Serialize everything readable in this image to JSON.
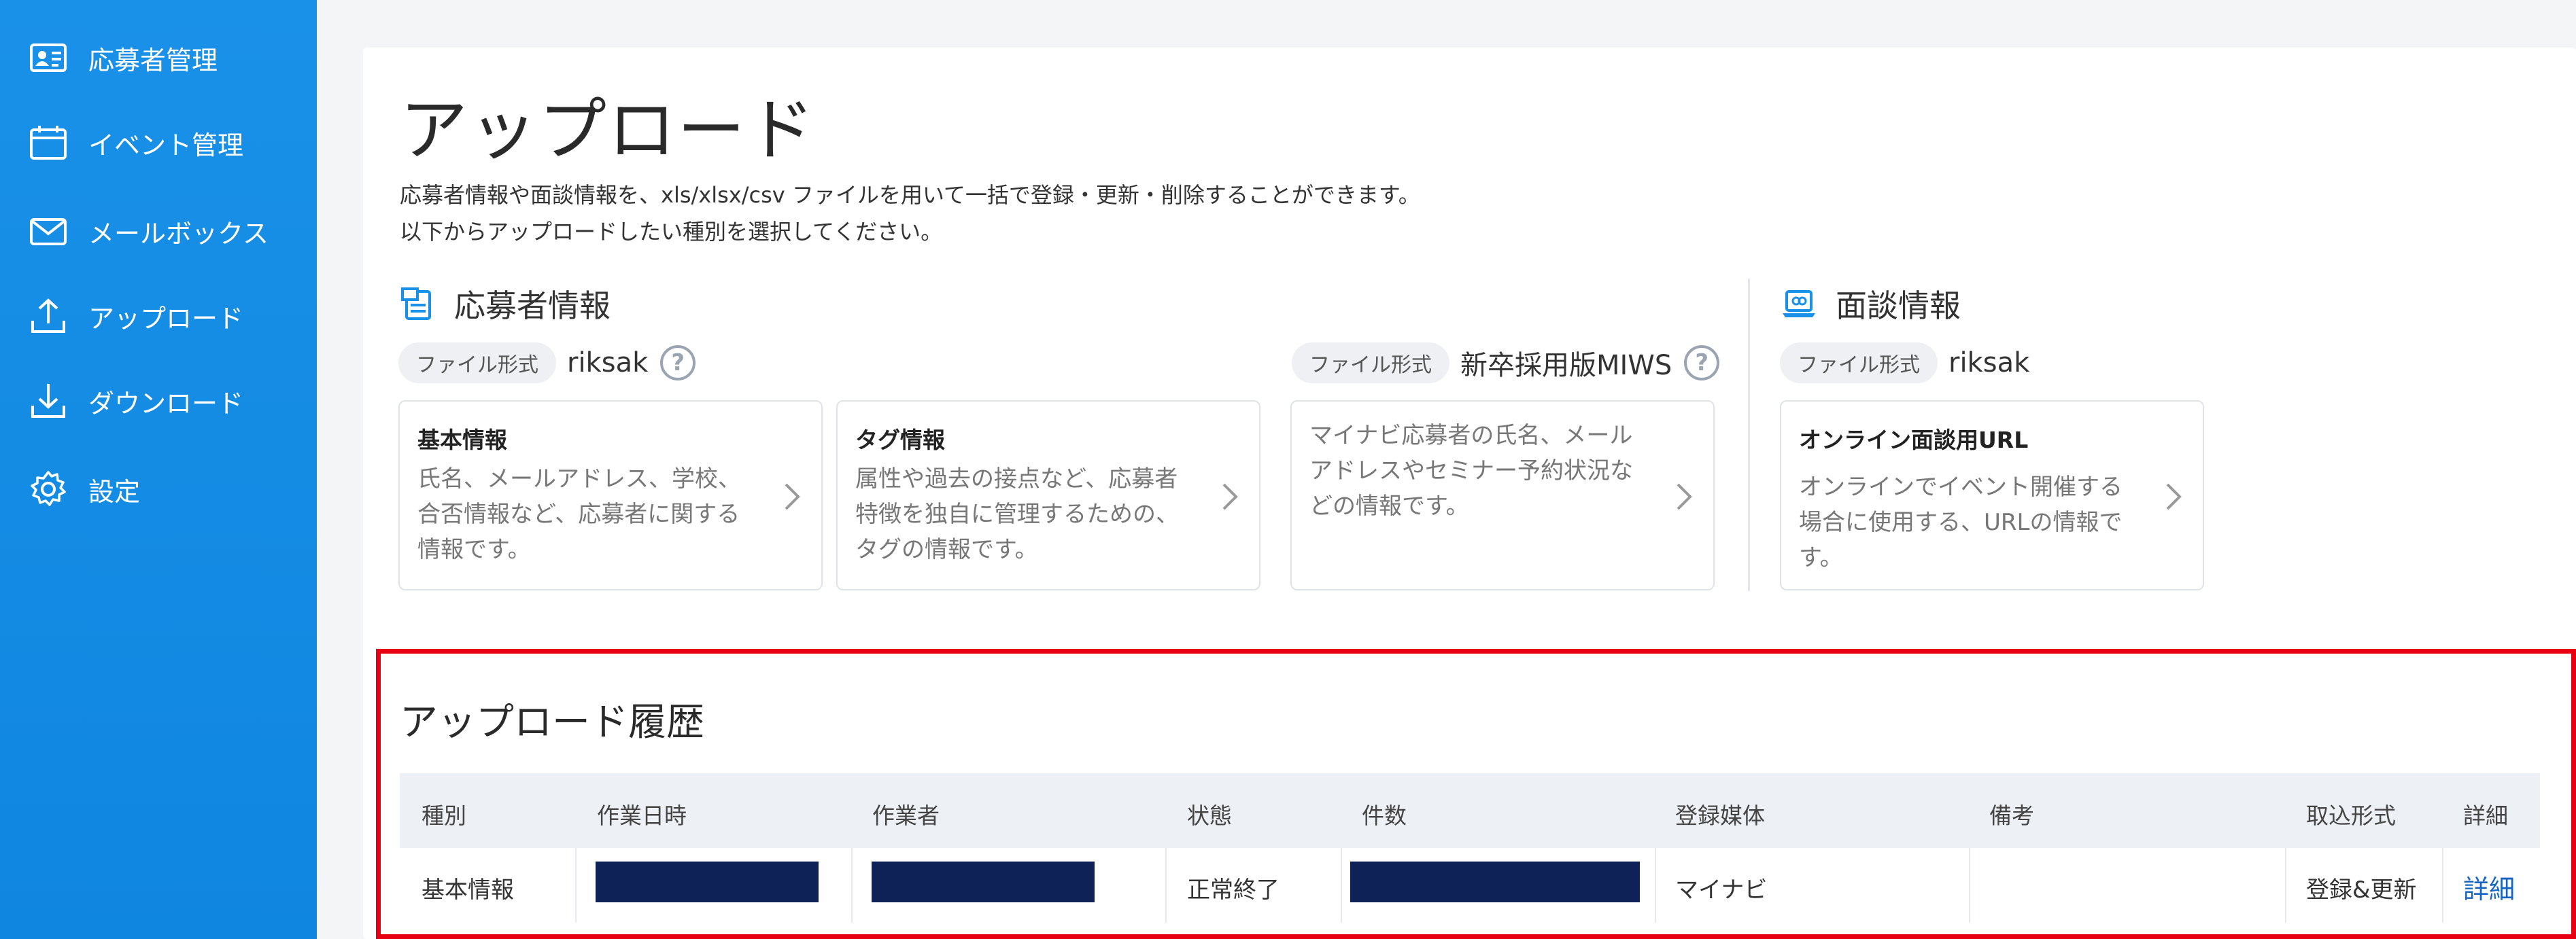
{
  "sidebar": {
    "items": [
      {
        "label": "応募者管理",
        "icon": "applicant-card-icon"
      },
      {
        "label": "イベント管理",
        "icon": "calendar-icon"
      },
      {
        "label": "メールボックス",
        "icon": "mail-icon"
      },
      {
        "label": "アップロード",
        "icon": "upload-icon"
      },
      {
        "label": "ダウンロード",
        "icon": "download-icon"
      },
      {
        "label": "設定",
        "icon": "gear-icon"
      }
    ]
  },
  "page": {
    "title": "アップロード",
    "description_1": "応募者情報や面談情報を、xls/xlsx/csv ファイルを用いて一括で登録・更新・削除することができます。",
    "description_2": "以下からアップロードしたい種別を選択してください。"
  },
  "applicant_section": {
    "title": "応募者情報",
    "format_label": "ファイル形式",
    "format_value_left": "riksak",
    "format_value_right": "新卒採用版MIWS",
    "help_glyph": "?",
    "cards": [
      {
        "title": "基本情報",
        "desc": [
          "氏名、メールアドレス、学校、",
          "合否情報など、応募者に関する",
          "情報です。"
        ]
      },
      {
        "title": "タグ情報",
        "desc": [
          "属性や過去の接点など、応募者",
          "特徴を独自に管理するための、",
          "タグの情報です。"
        ]
      },
      {
        "title": "",
        "desc": [
          "マイナビ応募者の氏名、メール",
          "アドレスやセミナー予約状況な",
          "どの情報です。"
        ]
      }
    ]
  },
  "interview_section": {
    "title": "面談情報",
    "format_label": "ファイル形式",
    "format_value": "riksak",
    "card": {
      "title": "オンライン面談用URL",
      "desc": [
        "オンラインでイベント開催する",
        "場合に使用する、URLの情報で",
        "す。"
      ]
    }
  },
  "history": {
    "title": "アップロード履歴",
    "columns": [
      "種別",
      "作業日時",
      "作業者",
      "状態",
      "件数",
      "登録媒体",
      "備考",
      "取込形式",
      "詳細"
    ],
    "rows": [
      {
        "type": "基本情報",
        "status": "正常終了",
        "media": "マイナビ",
        "note": "",
        "import_format": "登録&更新",
        "detail": "詳細"
      }
    ]
  },
  "colors": {
    "sidebar": "#1a91e8",
    "highlight": "#e60012",
    "redaction": "#0e2257",
    "link": "#1565c0"
  }
}
